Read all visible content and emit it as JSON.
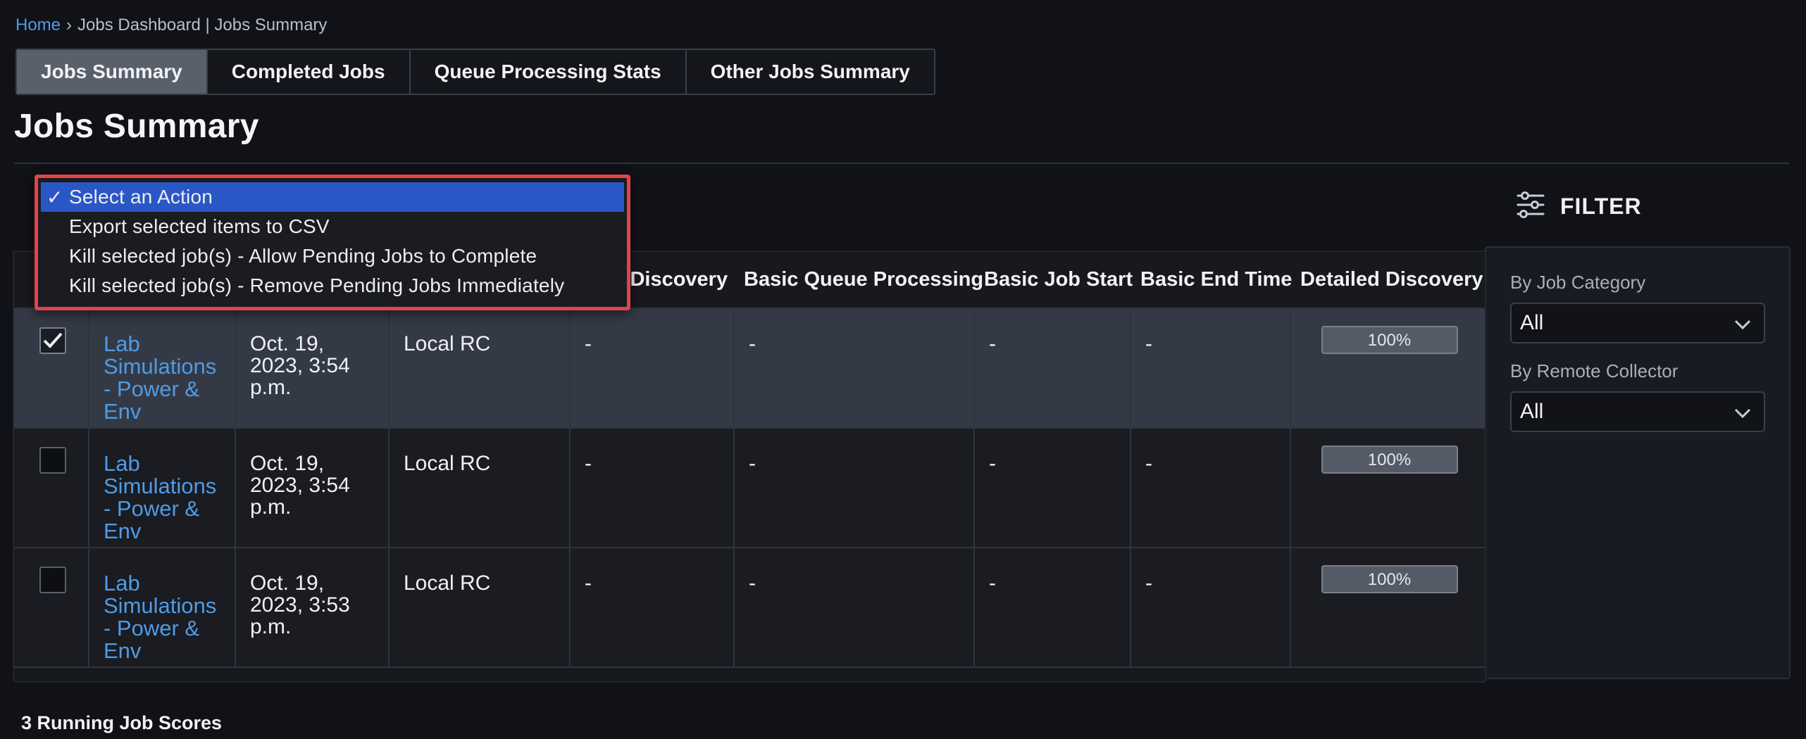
{
  "breadcrumb": {
    "home": "Home",
    "separator": "›",
    "path": "Jobs Dashboard | Jobs Summary"
  },
  "tabs": [
    {
      "label": "Jobs Summary",
      "active": true
    },
    {
      "label": "Completed Jobs",
      "active": false
    },
    {
      "label": "Queue Processing Stats",
      "active": false
    },
    {
      "label": "Other Jobs Summary",
      "active": false
    }
  ],
  "page_title": "Jobs Summary",
  "action_menu": {
    "items": [
      {
        "label": "Select an Action",
        "selected": true,
        "check": "✓"
      },
      {
        "label": "Export selected items to CSV",
        "selected": false
      },
      {
        "label": "Kill selected job(s) - Allow Pending Jobs to Complete",
        "selected": false
      },
      {
        "label": "Kill selected job(s) - Remove Pending Jobs Immediately",
        "selected": false
      }
    ]
  },
  "table": {
    "columns": [
      "",
      "",
      "",
      "",
      "Basic Discovery",
      "Basic Queue Processing",
      "Basic Job Start",
      "Basic End Time",
      "Detailed Discovery"
    ],
    "rows": [
      {
        "checked": true,
        "job": "Lab Simulations - Power & Env",
        "date": "Oct. 19, 2023, 3:54 p.m.",
        "collector": "Local RC",
        "basic_discovery": "-",
        "basic_queue": "-",
        "basic_start": "-",
        "basic_end": "-",
        "detailed_discovery": "100%"
      },
      {
        "checked": false,
        "job": "Lab Simulations - Power & Env",
        "date": "Oct. 19, 2023, 3:54 p.m.",
        "collector": "Local RC",
        "basic_discovery": "-",
        "basic_queue": "-",
        "basic_start": "-",
        "basic_end": "-",
        "detailed_discovery": "100%"
      },
      {
        "checked": false,
        "job": "Lab Simulations - Power & Env",
        "date": "Oct. 19, 2023, 3:53 p.m.",
        "collector": "Local RC",
        "basic_discovery": "-",
        "basic_queue": "-",
        "basic_start": "-",
        "basic_end": "-",
        "detailed_discovery": "100%"
      }
    ]
  },
  "filter": {
    "title": "FILTER",
    "job_category": {
      "label": "By Job Category",
      "value": "All"
    },
    "remote_collector": {
      "label": "By Remote Collector",
      "value": "All"
    }
  },
  "footer": {
    "running_scores": "3 Running Job Scores"
  },
  "colors": {
    "accent_link": "#4f9be6",
    "menu_highlight": "#2a57c6",
    "menu_border": "#e0444b"
  }
}
